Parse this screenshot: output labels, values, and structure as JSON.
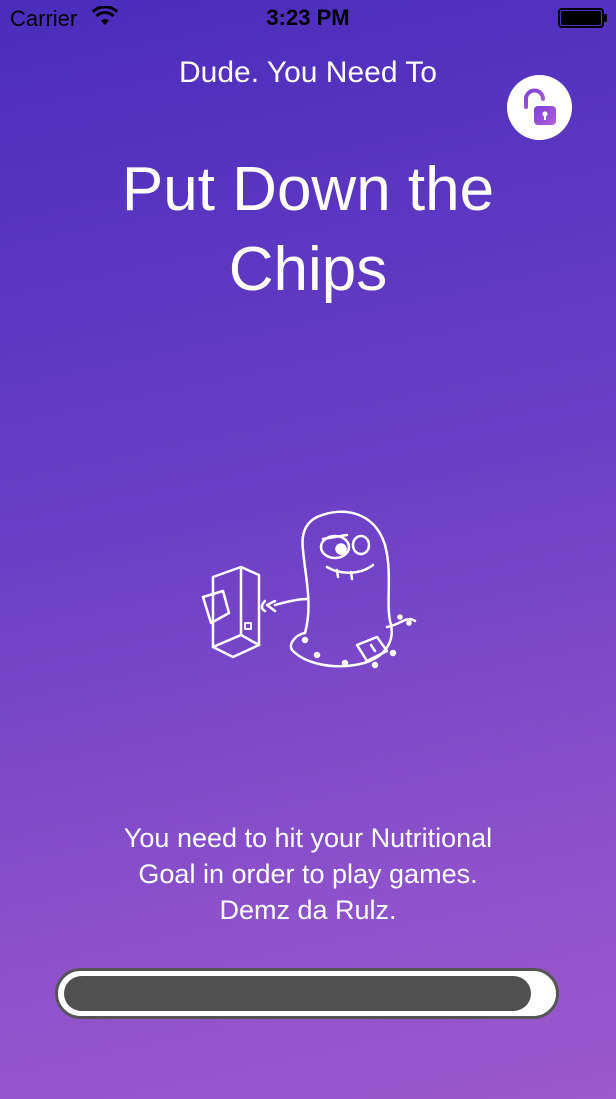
{
  "status_bar": {
    "carrier": "Carrier",
    "time": "3:23 PM"
  },
  "header": {
    "subtitle": "Dude. You Need To",
    "title_line1": "Put Down the",
    "title_line2": "Chips",
    "unlock_icon": "unlock-icon"
  },
  "illustration": {
    "icon": "cartoon-blob-with-game-console"
  },
  "message": {
    "line1": "You need to hit your Nutritional",
    "line2": "Goal in order to play games.",
    "line3": "Demz da Rulz."
  },
  "progress": {
    "value_fraction": 0.96
  },
  "colors": {
    "gradient_top": "#4a2dbb",
    "gradient_bottom": "#9c58cc",
    "accent": "#8c4fd9",
    "progress_fill": "#505050",
    "progress_track": "#ffffff"
  }
}
